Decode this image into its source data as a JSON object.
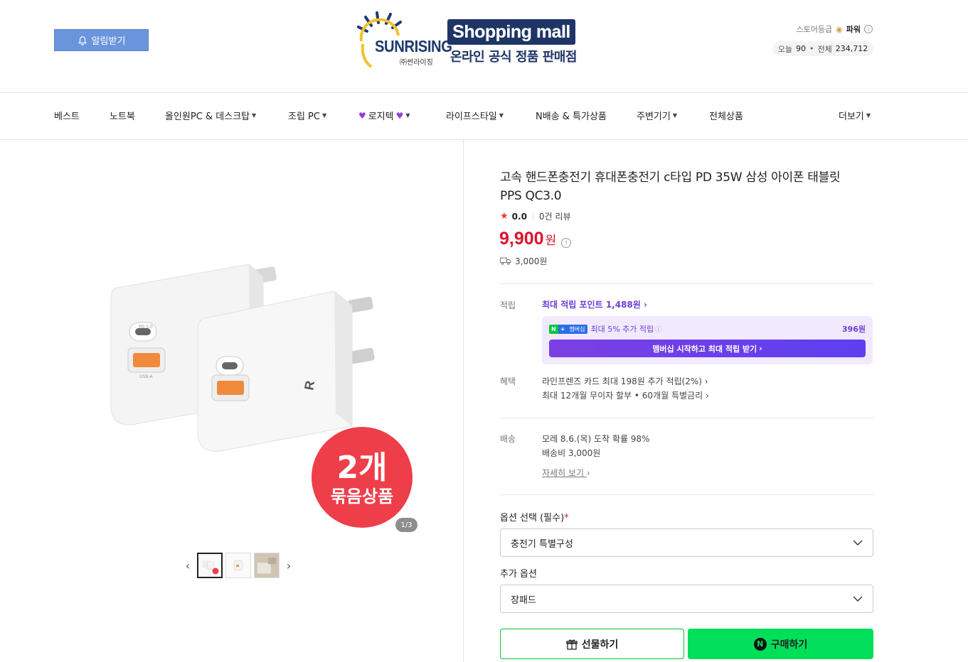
{
  "header": {
    "alarm_label": "알림받기",
    "logo_text": "SUNRISING",
    "logo_sub": "㈜썬라이징",
    "mall_title": "Shopping mall",
    "mall_sub": "온라인 공식 정품 판매점",
    "store_grade_label": "스토어등급",
    "store_grade_value": "파워",
    "today_label": "오늘",
    "today_value": "90",
    "total_label": "전체",
    "total_value": "234,712"
  },
  "nav": {
    "items": [
      "베스트",
      "노트북",
      "올인원PC & 데스크탑",
      "조립 PC",
      "로지텍",
      "라이프스타일",
      "N배송 & 특가상품",
      "주변기기",
      "전체상품"
    ],
    "more": "더보기"
  },
  "gallery": {
    "badge_line1": "2개",
    "badge_line2": "묶음상품",
    "pager": "1/3",
    "port_label_c": "PD 3.0",
    "port_label_a": "USB-A"
  },
  "product": {
    "title": "고속 핸드폰충전기 휴대폰충전기 c타입 PD 35W 삼성 아이폰 태블릿 PPS QC3.0",
    "rating": "0.0",
    "reviews": "0건 리뷰",
    "price": "9,900",
    "price_unit": "원",
    "shipping_fee": "3,000원"
  },
  "points": {
    "label": "적립",
    "max_point": "최대 적립 포인트 1,488원",
    "badge_n": "N",
    "badge_plus": "+",
    "badge_member": "멤버십",
    "member_text": "최대 5% 추가 적립",
    "member_amount": "396원",
    "member_button": "멤버십 시작하고 최대 적립 받기"
  },
  "benefits": {
    "label": "혜택",
    "line1": "라인프렌즈 카드 최대 198원 추가 적립(2%)",
    "line2": "최대 12개월 무이자 할부 • 60개월 특별금리"
  },
  "delivery": {
    "label": "배송",
    "line1": "모레 8.6.(목) 도착 확률 98%",
    "line2": "배송비 3,000원",
    "detail": "자세히 보기"
  },
  "options": {
    "required_label": "옵션 선택 (필수)",
    "required_mark": "*",
    "required_value": "충전기 특별구성",
    "extra_label": "추가 옵션",
    "extra_value": "장패드"
  },
  "actions": {
    "gift": "선물하기",
    "buy": "구매하기",
    "npay_mark": "N"
  },
  "colors": {
    "price_red": "#e0112b",
    "naver_green": "#00de5a",
    "member_purple": "#6a3fd8",
    "alarm_blue": "#6a95dc"
  }
}
